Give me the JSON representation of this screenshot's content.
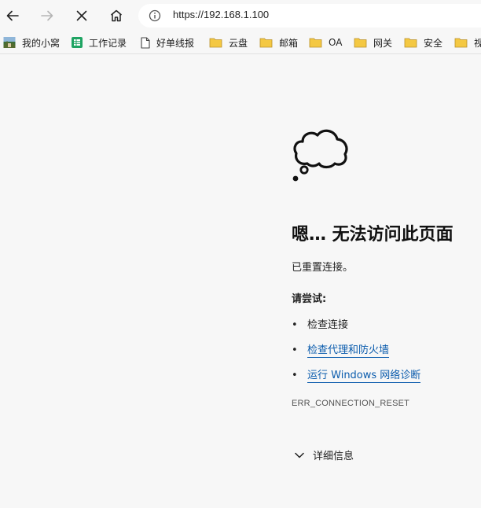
{
  "toolbar": {
    "url": "https://192.168.1.100"
  },
  "bookmarks": [
    {
      "label": "我的小窝",
      "icon": "landscape-image-icon"
    },
    {
      "label": "工作记录",
      "icon": "spreadsheet-icon"
    },
    {
      "label": "好单线报",
      "icon": "page-icon"
    },
    {
      "label": "云盘",
      "icon": "folder-icon"
    },
    {
      "label": "邮箱",
      "icon": "folder-icon"
    },
    {
      "label": "OA",
      "icon": "folder-icon"
    },
    {
      "label": "网关",
      "icon": "folder-icon"
    },
    {
      "label": "安全",
      "icon": "folder-icon"
    },
    {
      "label": "视",
      "icon": "folder-icon"
    }
  ],
  "error": {
    "title": "嗯… 无法访问此页面",
    "description": "已重置连接。",
    "try_heading": "请尝试:",
    "suggestions": [
      {
        "bullet": "•",
        "text": "检查连接",
        "link": false
      },
      {
        "bullet": "•",
        "text": "检查代理和防火墙",
        "link": true
      },
      {
        "bullet": "•",
        "text": "运行 Windows 网络诊断",
        "link": true
      }
    ],
    "error_code": "ERR_CONNECTION_RESET",
    "details_label": "详细信息"
  },
  "colors": {
    "link": "#0b5cad",
    "background": "#f7f7f7",
    "folder": "#f4c842"
  }
}
